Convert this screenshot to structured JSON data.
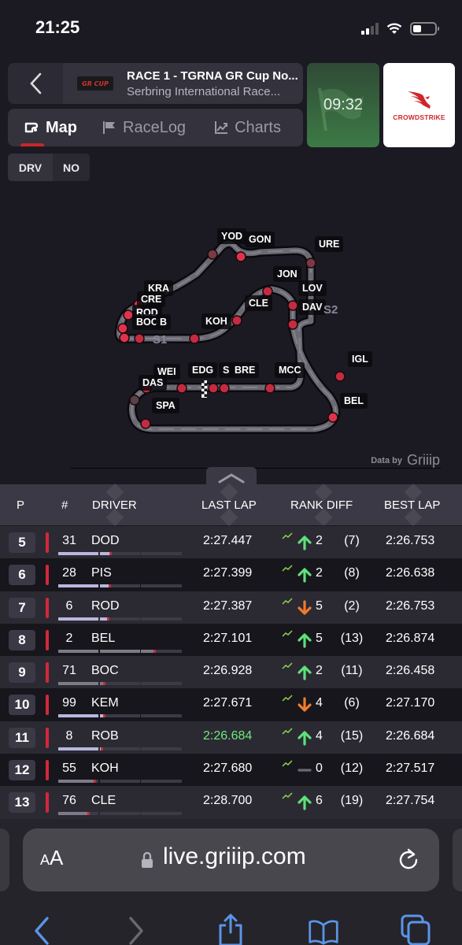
{
  "status_bar": {
    "time": "21:25",
    "battery_level": 0.4,
    "signal_bars": 2
  },
  "header": {
    "back_label": "<",
    "series_logo": "GR CUP",
    "race_title": "RACE 1 - TGRNA GR Cup No...",
    "race_subtitle": "Serbring International Race..."
  },
  "tabs": [
    {
      "label": "Map",
      "icon": "track-map-icon",
      "active": true
    },
    {
      "label": "RaceLog",
      "icon": "flag-icon",
      "active": false
    },
    {
      "label": "Charts",
      "icon": "chart-icon",
      "active": false
    }
  ],
  "timer": {
    "value": "09:32",
    "flag_state": "green"
  },
  "sponsor": {
    "name": "CROWDSTRIKE",
    "brand_color": "#d0262a"
  },
  "drv_toggle": {
    "label": "DRV",
    "value": "NO"
  },
  "map": {
    "labels": [
      "YOD",
      "GON",
      "URE",
      "JON",
      "LOV",
      "DAV",
      "KRA",
      "CRE",
      "ROD",
      "BOC",
      "B",
      "KOH",
      "CLE",
      "IGL",
      "WEI",
      "EDG",
      "S",
      "BRE",
      "MCC",
      "DAS",
      "SPA",
      "BEL"
    ],
    "sectors": [
      "S1",
      "S2"
    ],
    "attribution_prefix": "Data by",
    "attribution_brand": "Griiip"
  },
  "table": {
    "headers": {
      "pos": "P",
      "num": "#",
      "driver": "DRIVER",
      "last_lap": "LAST LAP",
      "rank_diff": "RANK DIFF",
      "best_lap": "BEST LAP"
    },
    "rows": [
      {
        "pos": "5",
        "num": "31",
        "driver": "DOD",
        "last_lap": "2:27.447",
        "direction": "up",
        "rank_diff": "2",
        "prev_rank": "(7)",
        "best_lap": "2:26.753",
        "lap_progress": 0.42,
        "fastest": false
      },
      {
        "pos": "6",
        "num": "28",
        "driver": "PIS",
        "last_lap": "2:27.399",
        "direction": "up",
        "rank_diff": "2",
        "prev_rank": "(8)",
        "best_lap": "2:26.638",
        "lap_progress": 0.41,
        "fastest": false
      },
      {
        "pos": "7",
        "num": "6",
        "driver": "ROD",
        "last_lap": "2:27.387",
        "direction": "down",
        "rank_diff": "5",
        "prev_rank": "(2)",
        "best_lap": "2:26.753",
        "lap_progress": 0.4,
        "fastest": false
      },
      {
        "pos": "8",
        "num": "2",
        "driver": "BEL",
        "last_lap": "2:27.101",
        "direction": "up",
        "rank_diff": "5",
        "prev_rank": "(13)",
        "best_lap": "2:26.874",
        "lap_progress": 0.77,
        "fastest": false
      },
      {
        "pos": "9",
        "num": "71",
        "driver": "BOC",
        "last_lap": "2:26.928",
        "direction": "up",
        "rank_diff": "2",
        "prev_rank": "(11)",
        "best_lap": "2:26.458",
        "lap_progress": 0.37,
        "fastest": false
      },
      {
        "pos": "10",
        "num": "99",
        "driver": "KEM",
        "last_lap": "2:27.671",
        "direction": "down",
        "rank_diff": "4",
        "prev_rank": "(6)",
        "best_lap": "2:27.170",
        "lap_progress": 0.37,
        "fastest": false
      },
      {
        "pos": "11",
        "num": "8",
        "driver": "ROB",
        "last_lap": "2:26.684",
        "direction": "up",
        "rank_diff": "4",
        "prev_rank": "(15)",
        "best_lap": "2:26.684",
        "lap_progress": 0.35,
        "fastest": true
      },
      {
        "pos": "12",
        "num": "55",
        "driver": "KOH",
        "last_lap": "2:27.680",
        "direction": "same",
        "rank_diff": "0",
        "prev_rank": "(12)",
        "best_lap": "2:27.517",
        "lap_progress": 0.29,
        "fastest": false
      },
      {
        "pos": "13",
        "num": "76",
        "driver": "CLE",
        "last_lap": "2:28.700",
        "direction": "up",
        "rank_diff": "6",
        "prev_rank": "(19)",
        "best_lap": "2:27.754",
        "lap_progress": 0.24,
        "fastest": false
      }
    ]
  },
  "colors": {
    "class_bar": "#d3283a",
    "up": "#5fe07a",
    "down": "#f07c2c",
    "same": "#6a6975",
    "fastest_lap": "#6ee87a",
    "sector_done_purple": "#b9b6e0",
    "sector_done_gray": "#7d7c86"
  },
  "browser": {
    "text_size_label": "AA",
    "url": "live.griiip.com"
  }
}
